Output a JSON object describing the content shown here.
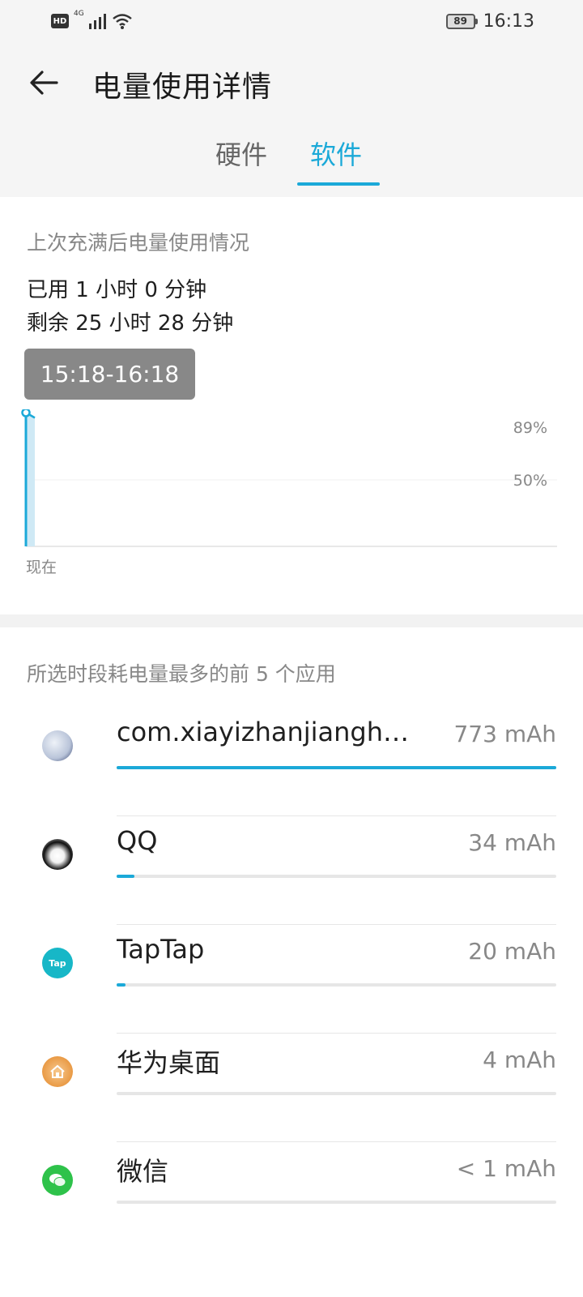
{
  "status_bar": {
    "hd": "HD",
    "network": "4G",
    "icons": [
      "signal-icon",
      "wifi-icon"
    ],
    "battery": "89",
    "time": "16:13"
  },
  "header": {
    "title": "电量使用详情",
    "back_icon": "arrow-left-icon"
  },
  "tabs": [
    {
      "label": "硬件",
      "selected": false
    },
    {
      "label": "软件",
      "selected": true
    }
  ],
  "usage": {
    "section_label": "上次充满后电量使用情况",
    "used": "已用 1 小时 0 分钟",
    "remaining": "剩余 25 小时 28 分钟",
    "range_button": "15:18-16:18"
  },
  "chart_data": {
    "type": "area",
    "x_label_end": "现在",
    "y_tick_labels": [
      "89%",
      "50%"
    ],
    "points": [
      {
        "t": "15:18",
        "level": 89
      },
      {
        "t": "16:18",
        "level": 86
      }
    ],
    "ylim": [
      0,
      100
    ],
    "accent_color": "#1ba9d8"
  },
  "apps": {
    "section_label": "所选时段耗电量最多的前 5 个应用",
    "accent_color": "#1ba9d8",
    "items": [
      {
        "name": "com.xiayizhanjianghu.…",
        "value": "773 mAh",
        "share": 1.0,
        "icon": "jianghu-app-icon",
        "icon_color": "#2d3c6a"
      },
      {
        "name": "QQ",
        "value": "34 mAh",
        "share": 0.04,
        "icon": "qq-penguin-icon",
        "icon_color": "#111111"
      },
      {
        "name": "TapTap",
        "value": "20 mAh",
        "share": 0.02,
        "icon": "taptap-icon",
        "icon_color": "#17b7c7"
      },
      {
        "name": "华为桌面",
        "value": "4 mAh",
        "share": 0.0,
        "icon": "home-icon",
        "icon_color": "#e99a45"
      },
      {
        "name": "微信",
        "value": "< 1 mAh",
        "share": 0.0,
        "icon": "wechat-icon",
        "icon_color": "#2ec24a"
      }
    ]
  }
}
